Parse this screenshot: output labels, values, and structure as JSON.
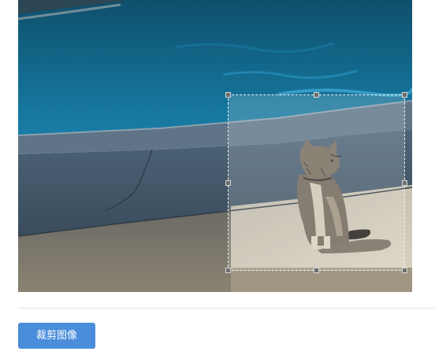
{
  "editor": {
    "crop_button_label": "裁剪图像"
  },
  "colors": {
    "button_bg": "#4a8ddb",
    "button_text": "#ffffff",
    "crop_border": "#f2f2f2",
    "handle": "#6e6e6e",
    "divider": "#e3e3e3"
  }
}
